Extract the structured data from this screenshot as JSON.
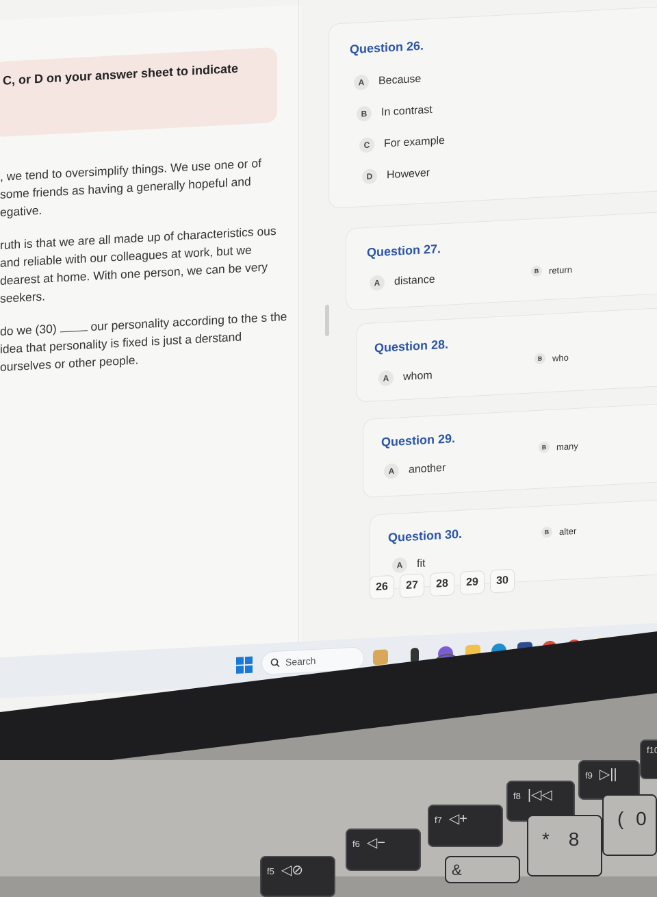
{
  "instruction": "C, or D on your answer sheet to indicate",
  "passage": {
    "p1": ", we tend to oversimplify things. We use one or of some friends as having a generally hopeful and egative.",
    "p2": "ruth is that we are all made up of characteristics ous and reliable with our colleagues at work, but we dearest at home. With one person, we can be very seekers.",
    "p3_before": "do we (30)",
    "p3_after": "our personality according to the s the idea that personality is fixed is just a derstand ourselves or other people."
  },
  "questions": [
    {
      "title": "Question 26.",
      "options": [
        {
          "letter": "A",
          "text": "Because"
        },
        {
          "letter": "B",
          "text": "In contrast"
        },
        {
          "letter": "C",
          "text": "For example"
        },
        {
          "letter": "D",
          "text": "However"
        }
      ]
    },
    {
      "title": "Question 27.",
      "options": [
        {
          "letter": "A",
          "text": "distance"
        },
        {
          "letter": "B",
          "text": "return"
        }
      ]
    },
    {
      "title": "Question 28.",
      "options": [
        {
          "letter": "A",
          "text": "whom"
        },
        {
          "letter": "B",
          "text": "who"
        }
      ]
    },
    {
      "title": "Question 29.",
      "options": [
        {
          "letter": "A",
          "text": "another"
        },
        {
          "letter": "B",
          "text": "many"
        }
      ]
    },
    {
      "title": "Question 30.",
      "options": [
        {
          "letter": "A",
          "text": "fit"
        },
        {
          "letter": "B",
          "text": "alter"
        }
      ]
    }
  ],
  "nav": [
    "26",
    "27",
    "28",
    "29",
    "30"
  ],
  "taskbar": {
    "search_label": "Search"
  },
  "keyboard": {
    "f5": "f5",
    "f6": "f6",
    "f7": "f7",
    "f8": "f8",
    "f9": "f9",
    "f10": "f10",
    "star": "*",
    "eight": "8",
    "ampersand": "&",
    "paren": "(",
    "zero": "0"
  },
  "colors": {
    "accent": "#2b55a8",
    "instruction_bg": "#f5e6e2",
    "windows_blue": "#1a78d6"
  }
}
